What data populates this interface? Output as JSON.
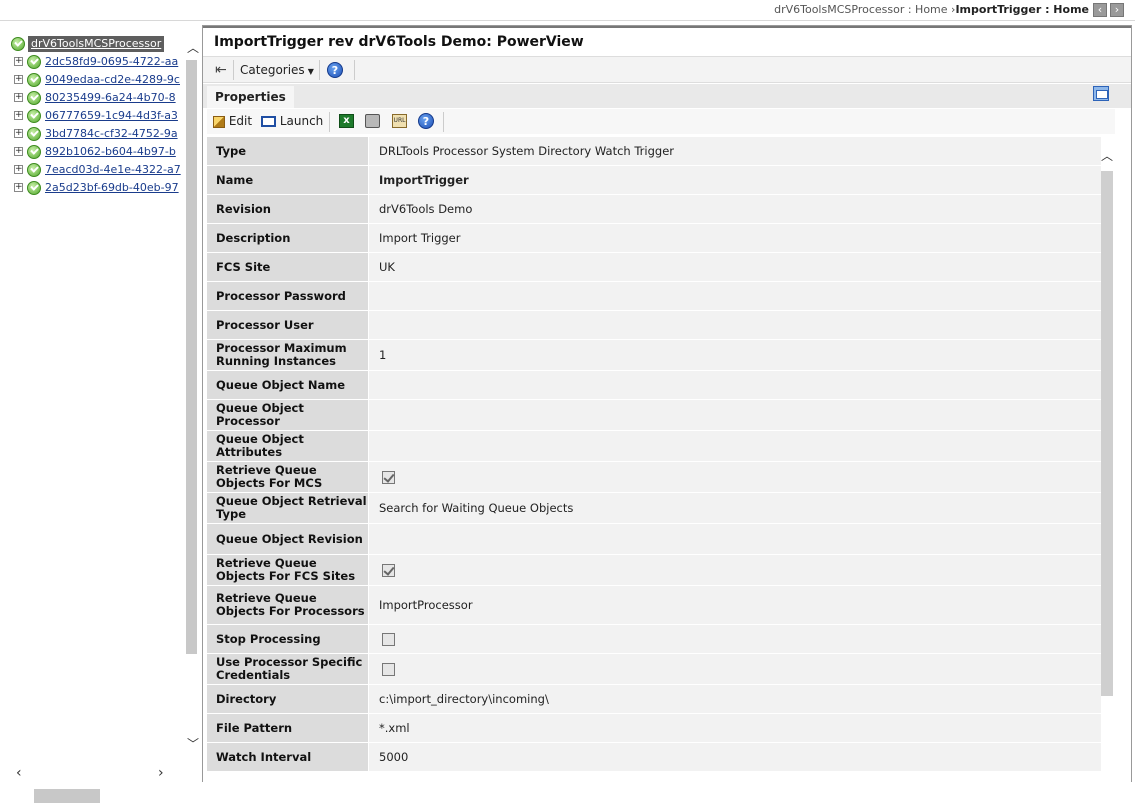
{
  "breadcrumb": {
    "parts": [
      "drV6ToolsMCSProcessor : Home",
      "ImportTrigger : Home"
    ],
    "separator": "›"
  },
  "tree": {
    "root": "drV6ToolsMCSProcessor",
    "items": [
      "2dc58fd9-0695-4722-aa",
      "9049edaa-cd2e-4289-9c",
      "80235499-6a24-4b70-8",
      "06777659-1c94-4d3f-a3",
      "3bd7784c-cf32-4752-9a",
      "892b1062-b604-4b97-b",
      "7eacd03d-4e1e-4322-a7",
      "2a5d23bf-69db-40eb-97"
    ]
  },
  "panel": {
    "title": "ImportTrigger rev drV6Tools Demo: PowerView",
    "categories_label": "Categories",
    "tab_label": "Properties",
    "edit_label": "Edit",
    "launch_label": "Launch"
  },
  "properties": [
    {
      "key": "Type",
      "value": "DRLTools Processor System Directory Watch Trigger"
    },
    {
      "key": "Name",
      "value": "ImportTrigger",
      "bold": true
    },
    {
      "key": "Revision",
      "value": "drV6Tools Demo"
    },
    {
      "key": "Description",
      "value": "Import Trigger"
    },
    {
      "key": "FCS Site",
      "value": "UK"
    },
    {
      "key": "Processor Password",
      "value": ""
    },
    {
      "key": "Processor User",
      "value": ""
    },
    {
      "key": "Processor Maximum Running Instances",
      "value": "1"
    },
    {
      "key": "Queue Object Name",
      "value": ""
    },
    {
      "key": "Queue Object Processor",
      "value": ""
    },
    {
      "key": "Queue Object Attributes",
      "value": ""
    },
    {
      "key": "Retrieve Queue Objects For MCS",
      "checkbox": true,
      "checked": true
    },
    {
      "key": "Queue Object Retrieval Type",
      "value": "Search for Waiting Queue Objects"
    },
    {
      "key": "Queue Object Revision",
      "value": ""
    },
    {
      "key": "Retrieve Queue Objects For FCS Sites",
      "checkbox": true,
      "checked": true
    },
    {
      "key": "Retrieve Queue Objects For Processors",
      "value": "ImportProcessor"
    },
    {
      "key": "Stop Processing",
      "checkbox": true,
      "checked": false
    },
    {
      "key": "Use Processor Specific Credentials",
      "checkbox": true,
      "checked": false
    },
    {
      "key": "Directory",
      "value": "c:\\import_directory\\incoming\\"
    },
    {
      "key": "File Pattern",
      "value": "*.xml"
    },
    {
      "key": "Watch Interval",
      "value": "5000"
    }
  ]
}
